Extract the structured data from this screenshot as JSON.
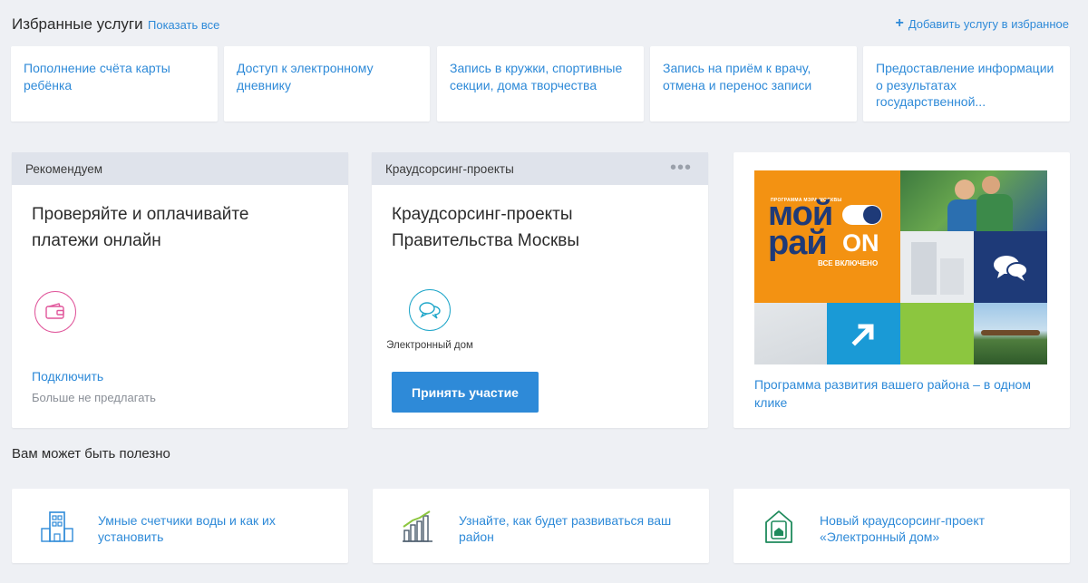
{
  "favorites": {
    "title": "Избранные услуги",
    "show_all": "Показать все",
    "add_label": "Добавить услугу в избранное",
    "items": [
      {
        "label": "Пополнение счёта карты ребёнка"
      },
      {
        "label": "Доступ к электронному дневнику"
      },
      {
        "label": "Запись в кружки, спортивные секции, дома творчества"
      },
      {
        "label": "Запись на приём к врачу, отмена и перенос записи"
      },
      {
        "label": "Предоставление информации о результатах государственной..."
      }
    ]
  },
  "recommend": {
    "header": "Рекомендуем",
    "title": "Проверяйте и оплачивайте платежи онлайн",
    "icon": "wallet-icon",
    "connect": "Подключить",
    "dismiss": "Больше не предлагать"
  },
  "crowdsourcing": {
    "header": "Краудсорсинг-проекты",
    "menu": "•••",
    "title": "Краудсорсинг-проекты Правительства Москвы",
    "icon": "chat-bubbles-icon",
    "project_label": "Электронный дом",
    "button": "Принять участие"
  },
  "banner": {
    "small_caption": "ПРОГРАММА МЭРА МОСКВЫ",
    "logo_line1": "мой",
    "logo_line2": "рай",
    "logo_on": "ON",
    "tagline": "ВСЕ ВКЛЮЧЕНО",
    "link": "Программа развития вашего района – в одном клике",
    "colors": {
      "orange": "#f39212",
      "navy": "#1e3a78",
      "blue": "#1a9ad6",
      "green": "#8cc63f"
    }
  },
  "useful": {
    "title": "Вам может быть полезно",
    "items": [
      {
        "label": "Умные счетчики воды и как их установить",
        "icon": "building-icon"
      },
      {
        "label": "Узнайте, как будет развиваться ваш район",
        "icon": "city-chart-icon"
      },
      {
        "label": "Новый краудсорсинг-проект «Электронный дом»",
        "icon": "smart-house-icon"
      }
    ]
  }
}
